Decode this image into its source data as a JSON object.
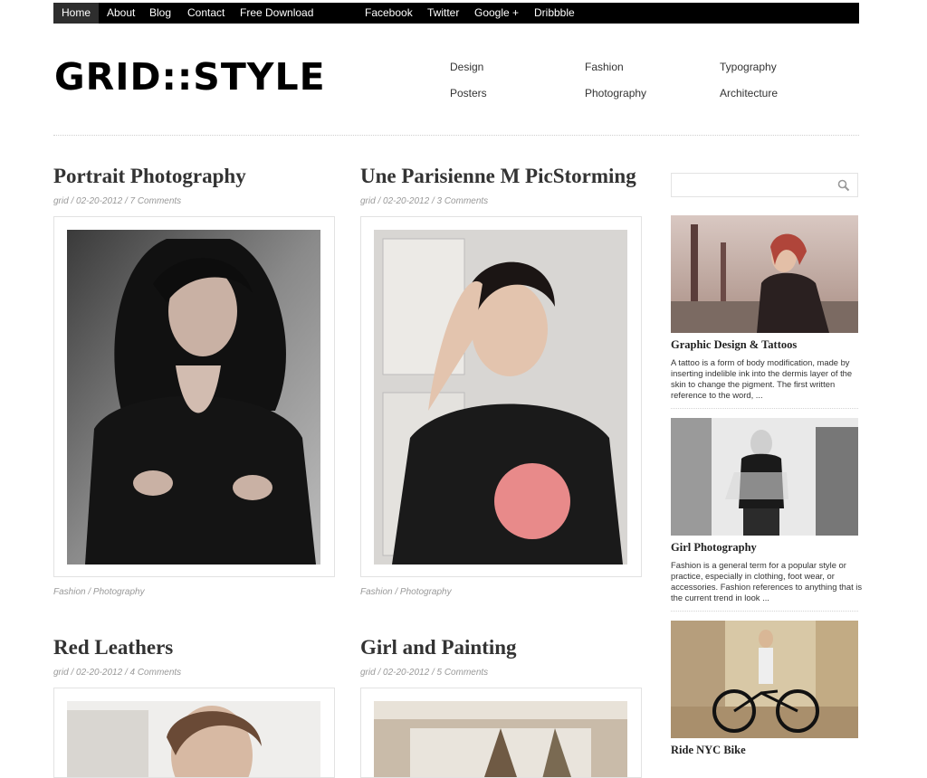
{
  "nav": {
    "items": [
      "Home",
      "About",
      "Blog",
      "Contact",
      "Free Download"
    ],
    "social": [
      "Facebook",
      "Twitter",
      "Google +",
      "Dribbble"
    ]
  },
  "logo": "GRID::STYLE",
  "categories": [
    "Design",
    "Fashion",
    "Typography",
    "Posters",
    "Photography",
    "Architecture"
  ],
  "posts": [
    {
      "title": "Portrait Photography",
      "meta": "grid / 02-20-2012 / 7 Comments",
      "tags": "Fashion / Photography"
    },
    {
      "title": "Une Parisienne M PicStorming",
      "meta": "grid / 02-20-2012 / 3 Comments",
      "tags": "Fashion / Photography"
    },
    {
      "title": "Red Leathers",
      "meta": "grid / 02-20-2012 / 4 Comments"
    },
    {
      "title": "Girl and Painting",
      "meta": "grid / 02-20-2012 / 5 Comments"
    }
  ],
  "search": {
    "placeholder": "",
    "icon": "search-icon"
  },
  "sidebar": {
    "items": [
      {
        "title": "Graphic Design & Tattoos",
        "text": "A tattoo is a form of body modification, made by inserting indelible ink into the dermis layer of the skin to change the pigment. The first written reference to the word, ..."
      },
      {
        "title": "Girl Photography",
        "text": "Fashion is a general term for a popular style or practice, especially in clothing, foot wear, or accessories. Fashion references to anything that is the current trend in look ..."
      },
      {
        "title": "Ride NYC Bike"
      }
    ]
  },
  "colors": {
    "topbar": "#000000",
    "accent": "#333333",
    "meta": "#999999"
  }
}
